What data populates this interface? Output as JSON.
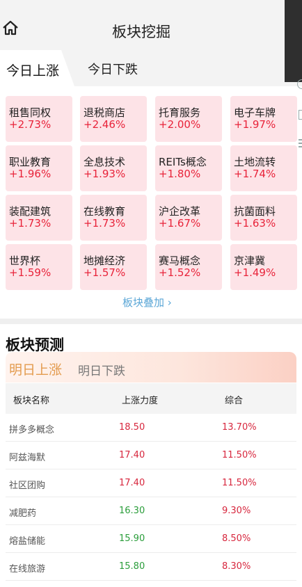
{
  "header": {
    "title": "板块挖掘"
  },
  "tabs": {
    "active": "今日上涨",
    "inactive": "今日下跌"
  },
  "cards": [
    {
      "name": "租售同权",
      "value": "+2.73%"
    },
    {
      "name": "退税商店",
      "value": "+2.46%"
    },
    {
      "name": "托育服务",
      "value": "+2.00%"
    },
    {
      "name": "电子车牌",
      "value": "+1.97%"
    },
    {
      "name": "职业教育",
      "value": "+1.96%"
    },
    {
      "name": "全息技术",
      "value": "+1.93%"
    },
    {
      "name": "REITs概念",
      "value": "+1.80%"
    },
    {
      "name": "土地流转",
      "value": "+1.74%"
    },
    {
      "name": "装配建筑",
      "value": "+1.73%"
    },
    {
      "name": "在线教育",
      "value": "+1.73%"
    },
    {
      "name": "沪企改革",
      "value": "+1.67%"
    },
    {
      "name": "抗菌面料",
      "value": "+1.63%"
    },
    {
      "name": "世界杯",
      "value": "+1.59%"
    },
    {
      "name": "地摊经济",
      "value": "+1.57%"
    },
    {
      "name": "赛马概念",
      "value": "+1.52%"
    },
    {
      "name": "京津冀",
      "value": "+1.49%"
    }
  ],
  "more_link": "板块叠加",
  "prediction": {
    "title": "板块预测",
    "tab_active": "明日上涨",
    "tab_inactive": "明日下跌",
    "columns": [
      "板块名称",
      "上涨力度",
      "综合"
    ],
    "rows": [
      {
        "name": "拼多多概念",
        "strength": "18.50",
        "total": "13.70%",
        "color": "#d7263d"
      },
      {
        "name": "阿兹海默",
        "strength": "17.40",
        "total": "11.50%",
        "color": "#d7263d"
      },
      {
        "name": "社区团购",
        "strength": "17.40",
        "total": "11.50%",
        "color": "#d7263d"
      },
      {
        "name": "减肥药",
        "strength": "16.30",
        "total": "9.30%",
        "color": "#2a9d3a"
      },
      {
        "name": "熔盐储能",
        "strength": "15.90",
        "total": "8.50%",
        "color": "#2a9d3a"
      },
      {
        "name": "在线旅游",
        "strength": "15.80",
        "total": "8.30%",
        "color": "#2a9d3a"
      }
    ]
  },
  "colors": {
    "up": "#e8233a",
    "card_bg": "#fde3e7",
    "link": "#5aa6d6",
    "accent": "#e39b4e"
  }
}
